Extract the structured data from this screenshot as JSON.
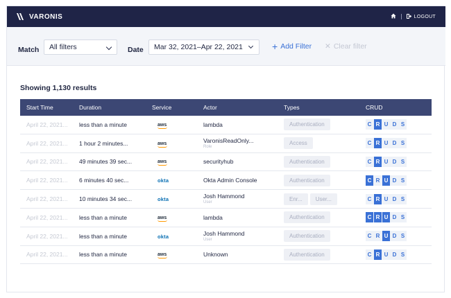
{
  "app": {
    "logo_text": "VARONIS",
    "logout_label": "LOGOUT"
  },
  "filters": {
    "match_label": "Match",
    "match_value": "All filters",
    "date_label": "Date",
    "date_value": "Mar 32, 2021–Apr 22, 2021",
    "add_filter": "Add Filter",
    "clear_filter": "Clear filter"
  },
  "results_text": "Showing 1,130 results",
  "columns": [
    "Start Time",
    "Duration",
    "Service",
    "Actor",
    "Types",
    "CRUD"
  ],
  "crud_letters": [
    "C",
    "R",
    "U",
    "D",
    "S"
  ],
  "rows": [
    {
      "start": "April 22, 2021...",
      "duration": "less than a minute",
      "service": "aws",
      "actor": "lambda",
      "actor_sub": "",
      "types": [
        "Authentication"
      ],
      "crud_on": [
        false,
        true,
        false,
        false,
        false
      ]
    },
    {
      "start": "April 22, 2021...",
      "duration": "1 hour 2 minutes...",
      "service": "aws",
      "actor": "VaronisReadOnly...",
      "actor_sub": "Role",
      "types": [
        "Access"
      ],
      "crud_on": [
        false,
        true,
        false,
        false,
        false
      ]
    },
    {
      "start": "April 22, 2021...",
      "duration": "49 minutes 39 sec...",
      "service": "aws",
      "actor": "securityhub",
      "actor_sub": "",
      "types": [
        "Authentication"
      ],
      "crud_on": [
        false,
        true,
        false,
        false,
        false
      ]
    },
    {
      "start": "April 22, 2021...",
      "duration": "6 minutes 40 sec...",
      "service": "okta",
      "actor": "Okta Admin Console",
      "actor_sub": "",
      "types": [
        "Authentication"
      ],
      "crud_on": [
        true,
        false,
        true,
        false,
        false
      ]
    },
    {
      "start": "April 22, 2021...",
      "duration": "10 minutes 34 sec...",
      "service": "okta",
      "actor": "Josh Hammond",
      "actor_sub": "User",
      "types": [
        "Enr...",
        "User..."
      ],
      "crud_on": [
        false,
        true,
        false,
        false,
        false
      ]
    },
    {
      "start": "April 22, 2021...",
      "duration": "less than a minute",
      "service": "aws",
      "actor": "lambda",
      "actor_sub": "",
      "types": [
        "Authentication"
      ],
      "crud_on": [
        true,
        true,
        true,
        false,
        false
      ]
    },
    {
      "start": "April 22, 2021...",
      "duration": "less than a minute",
      "service": "okta",
      "actor": "Josh Hammond",
      "actor_sub": "User",
      "types": [
        "Authentication"
      ],
      "crud_on": [
        false,
        false,
        true,
        false,
        false
      ]
    },
    {
      "start": "April 22, 2021...",
      "duration": "less than a minute",
      "service": "aws",
      "actor": "Unknown",
      "actor_sub": "",
      "types": [
        "Authentication"
      ],
      "crud_on": [
        false,
        true,
        false,
        false,
        false
      ]
    }
  ],
  "icons": {
    "home": "home-icon",
    "logout": "logout-icon",
    "add": "plus-icon",
    "clear": "close-icon"
  },
  "colors": {
    "topbar": "#1f2447",
    "header": "#3c4774",
    "accent": "#3a71d6"
  }
}
